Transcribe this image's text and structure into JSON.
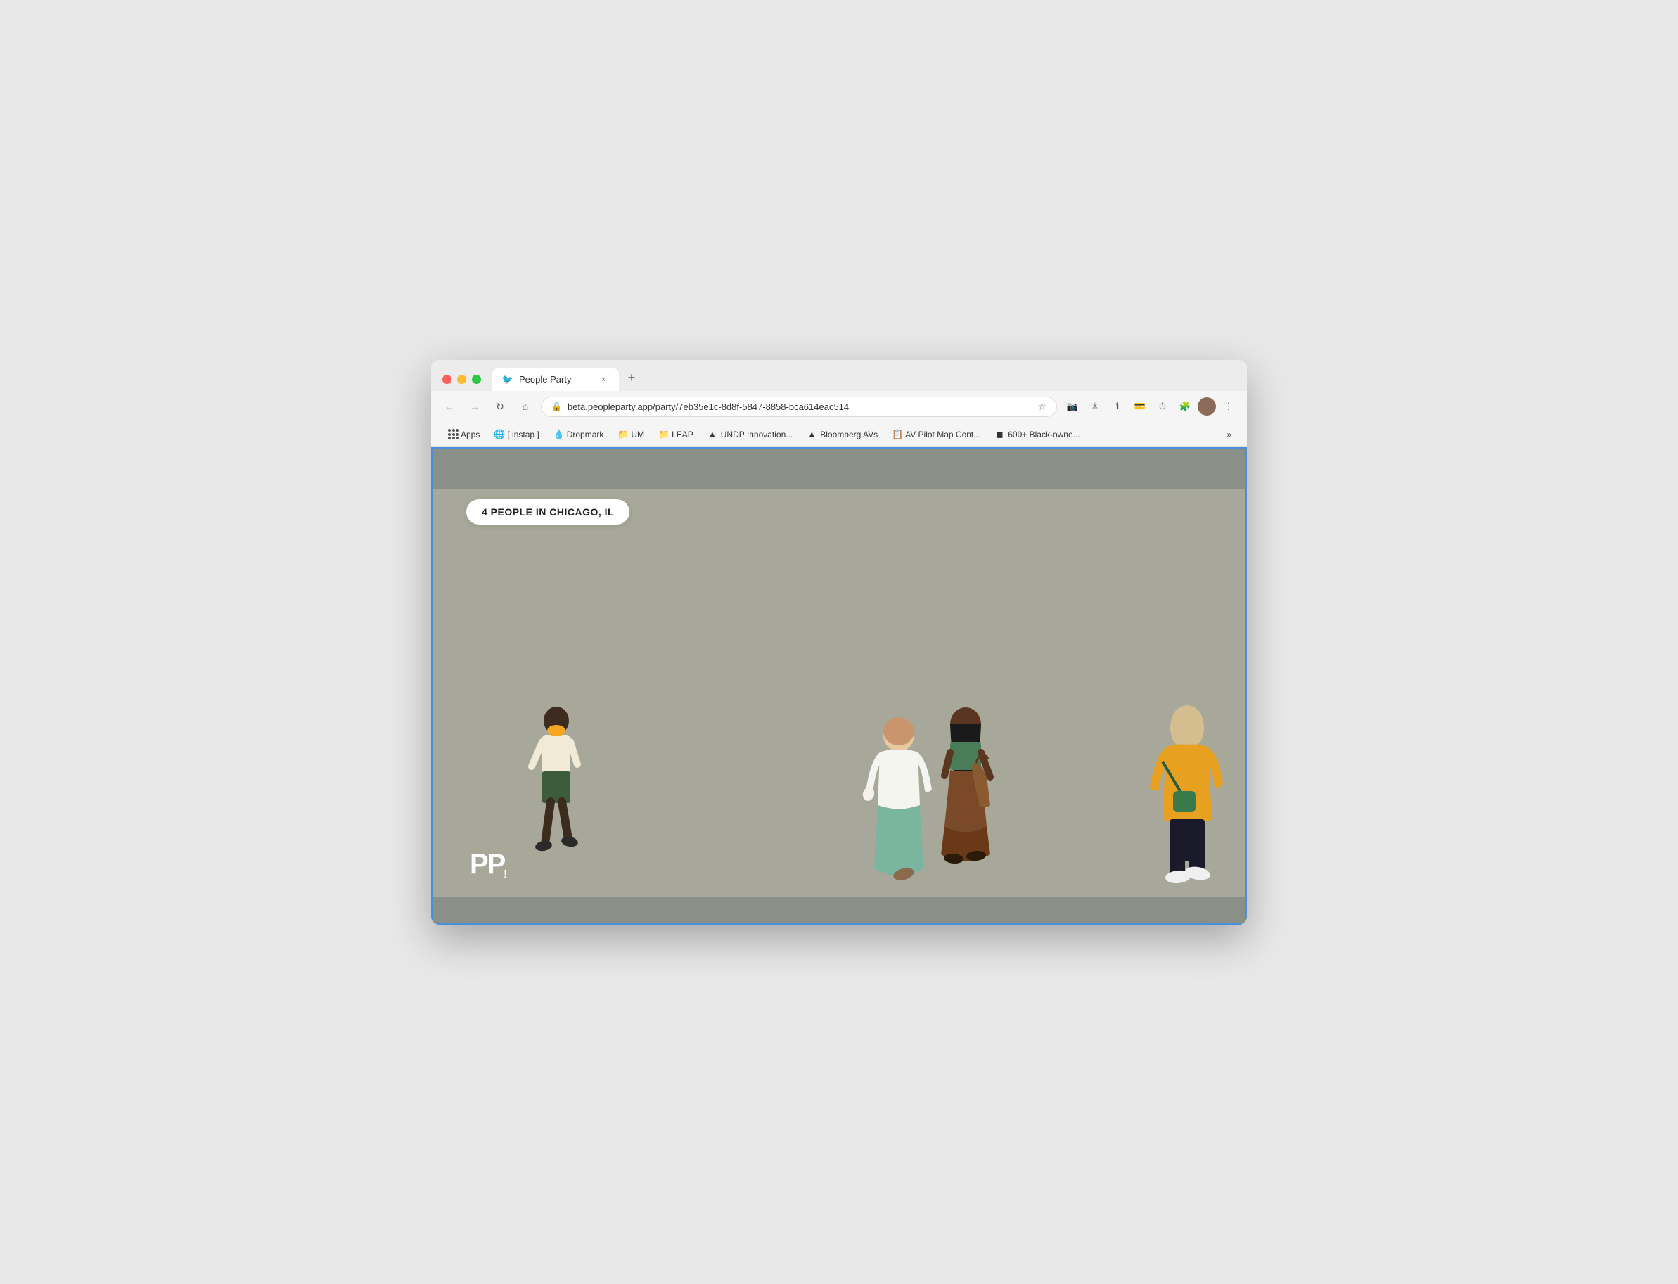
{
  "browser": {
    "tab": {
      "favicon": "🐦",
      "title": "People Party",
      "close": "×"
    },
    "new_tab": "+",
    "nav": {
      "back": "←",
      "forward": "→",
      "refresh": "↻",
      "home": "⌂",
      "url": "beta.peopleparty.app/party/7eb35e1c-8d8f-5847-8858-bca614eac514",
      "lock": "🔒"
    },
    "bookmarks": [
      {
        "id": "apps",
        "label": "Apps",
        "icon": "grid"
      },
      {
        "id": "instap",
        "label": "[ instap ]",
        "icon": "globe"
      },
      {
        "id": "dropmark",
        "label": "Dropmark",
        "icon": "drop"
      },
      {
        "id": "um",
        "label": "UM",
        "icon": "folder"
      },
      {
        "id": "leap",
        "label": "LEAP",
        "icon": "folder"
      },
      {
        "id": "undp",
        "label": "UNDP Innovation...",
        "icon": "drive"
      },
      {
        "id": "bloomberg",
        "label": "Bloomberg AVs",
        "icon": "drive"
      },
      {
        "id": "av-pilot",
        "label": "AV Pilot Map Cont...",
        "icon": "evernote"
      },
      {
        "id": "600-black",
        "label": "600+ Black-owne...",
        "icon": "notion"
      }
    ],
    "more": "»"
  },
  "page": {
    "location_badge": "4 PEOPLE IN CHICAGO, IL",
    "logo": "PP!",
    "background_color": "#a8a89a",
    "strip_color": "#8a9088"
  }
}
